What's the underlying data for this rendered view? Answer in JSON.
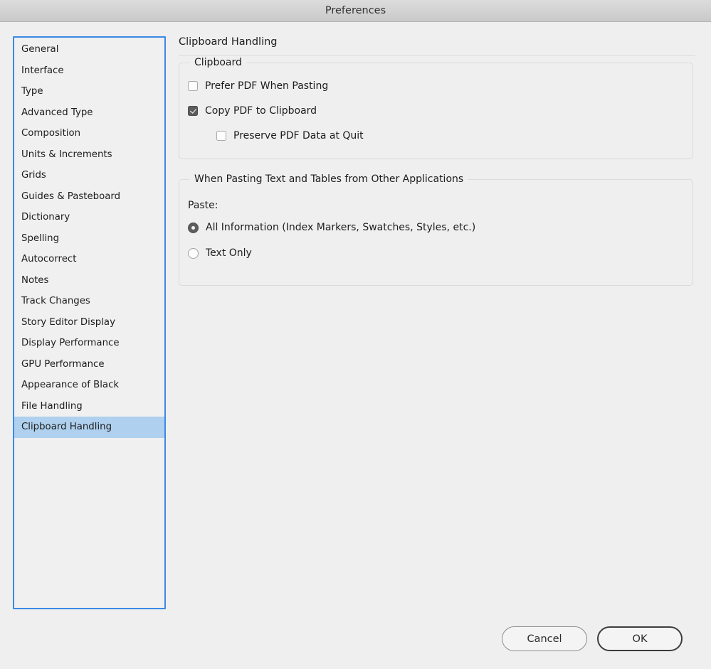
{
  "window": {
    "title": "Preferences"
  },
  "sidebar": {
    "items": [
      {
        "label": "General",
        "selected": false
      },
      {
        "label": "Interface",
        "selected": false
      },
      {
        "label": "Type",
        "selected": false
      },
      {
        "label": "Advanced Type",
        "selected": false
      },
      {
        "label": "Composition",
        "selected": false
      },
      {
        "label": "Units & Increments",
        "selected": false
      },
      {
        "label": "Grids",
        "selected": false
      },
      {
        "label": "Guides & Pasteboard",
        "selected": false
      },
      {
        "label": "Dictionary",
        "selected": false
      },
      {
        "label": "Spelling",
        "selected": false
      },
      {
        "label": "Autocorrect",
        "selected": false
      },
      {
        "label": "Notes",
        "selected": false
      },
      {
        "label": "Track Changes",
        "selected": false
      },
      {
        "label": "Story Editor Display",
        "selected": false
      },
      {
        "label": "Display Performance",
        "selected": false
      },
      {
        "label": "GPU Performance",
        "selected": false
      },
      {
        "label": "Appearance of Black",
        "selected": false
      },
      {
        "label": "File Handling",
        "selected": false
      },
      {
        "label": "Clipboard Handling",
        "selected": true
      }
    ],
    "selection_color": "#afd0ee",
    "focus_border_color": "#3b8ae5"
  },
  "panel": {
    "title": "Clipboard Handling",
    "clipboard_group": {
      "legend": "Clipboard",
      "options": [
        {
          "label": "Prefer PDF When Pasting",
          "checked": false
        },
        {
          "label": "Copy PDF to Clipboard",
          "checked": true
        },
        {
          "label": "Preserve PDF Data at Quit",
          "checked": false
        }
      ]
    },
    "pasting_group": {
      "legend": "When Pasting Text and Tables from Other Applications",
      "paste_label": "Paste:",
      "options": [
        {
          "label": "All Information (Index Markers, Swatches, Styles, etc.)",
          "selected": true
        },
        {
          "label": "Text Only",
          "selected": false
        }
      ]
    }
  },
  "footer": {
    "cancel_label": "Cancel",
    "ok_label": "OK"
  }
}
